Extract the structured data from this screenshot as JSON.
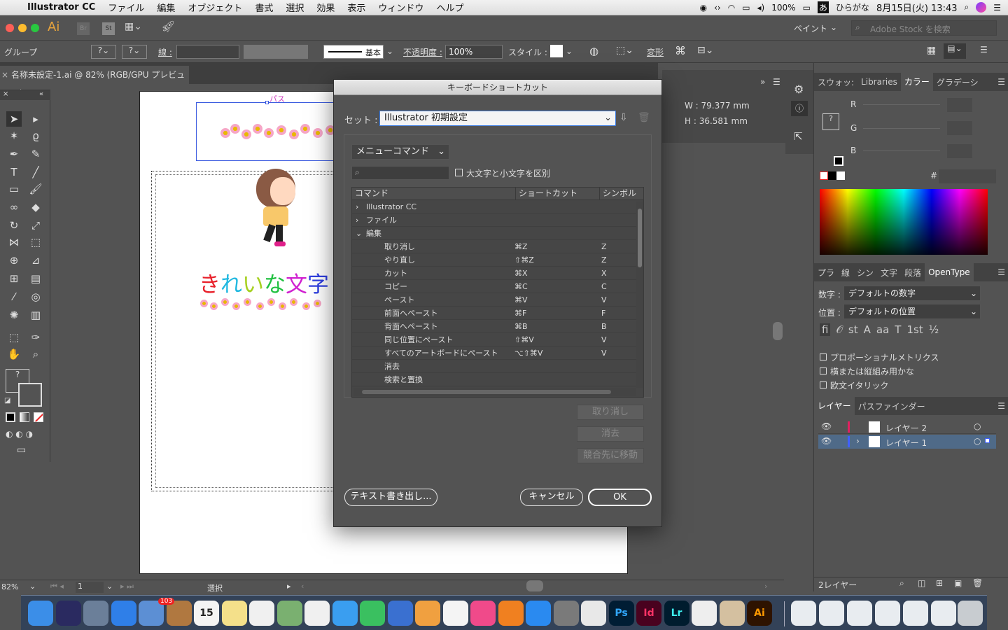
{
  "menubar": {
    "app": "Illustrator CC",
    "menus": [
      "ファイル",
      "編集",
      "オブジェクト",
      "書式",
      "選択",
      "効果",
      "表示",
      "ウィンドウ",
      "ヘルプ"
    ],
    "battery": "100%",
    "input": "ひらがな",
    "datetime": "8月15日(火) 13:43"
  },
  "appbar": {
    "ai": "Ai",
    "br": "Br",
    "st": "St",
    "workspace": "ペイント",
    "stock_placeholder": "Adobe Stock を検索"
  },
  "control": {
    "group": "グループ",
    "stroke_label": "線 :",
    "stroke_style": "基本",
    "opacity_label": "不透明度 :",
    "opacity": "100%",
    "style_label": "スタイル :",
    "transform": "変形"
  },
  "doc": {
    "tab": "名称未設定-1.ai @ 82% (RGB/GPU プレビュー)",
    "path_label": "パス",
    "art_text": [
      "き",
      "れ",
      "い",
      "な",
      "文",
      "字"
    ],
    "art_colors": [
      "#e8202a",
      "#20b8e0",
      "#a6d020",
      "#20c040",
      "#d020d0",
      "#3040e0"
    ]
  },
  "info": {
    "w": "W : 79.377 mm",
    "h": "H : 36.581 mm"
  },
  "status": {
    "zoom": "82%",
    "page": "1",
    "tool": "選択"
  },
  "dialog": {
    "title": "キーボードショートカット",
    "set_label": "セット :",
    "set_value": "Illustrator 初期設定",
    "category": "メニューコマンド",
    "case_label": "大文字と小文字を区別",
    "headers": [
      "コマンド",
      "ショートカット",
      "シンボル"
    ],
    "tree": [
      {
        "label": "Illustrator CC",
        "arrow": "›"
      },
      {
        "label": "ファイル",
        "arrow": "›"
      },
      {
        "label": "編集",
        "arrow": "⌄"
      }
    ],
    "commands": [
      {
        "name": "取り消し",
        "shortcut": "⌘Z",
        "symbol": "Z"
      },
      {
        "name": "やり直し",
        "shortcut": "⇧⌘Z",
        "symbol": "Z"
      },
      {
        "name": "カット",
        "shortcut": "⌘X",
        "symbol": "X"
      },
      {
        "name": "コピー",
        "shortcut": "⌘C",
        "symbol": "C"
      },
      {
        "name": "ペースト",
        "shortcut": "⌘V",
        "symbol": "V"
      },
      {
        "name": "前面へペースト",
        "shortcut": "⌘F",
        "symbol": "F"
      },
      {
        "name": "背面へペースト",
        "shortcut": "⌘B",
        "symbol": "B"
      },
      {
        "name": "同じ位置にペースト",
        "shortcut": "⇧⌘V",
        "symbol": "V"
      },
      {
        "name": "すべてのアートボードにペースト",
        "shortcut": "⌥⇧⌘V",
        "symbol": "V"
      },
      {
        "name": "消去",
        "shortcut": "",
        "symbol": ""
      },
      {
        "name": "検索と置換",
        "shortcut": "",
        "symbol": ""
      }
    ],
    "undo": "取り消し",
    "clear": "消去",
    "goto": "競合先に移動",
    "export": "テキスト書き出し...",
    "cancel": "キャンセル",
    "ok": "OK"
  },
  "panels": {
    "color_tabs": [
      "スウォッ:",
      "Libraries",
      "カラー",
      "グラデーシ"
    ],
    "rgb": [
      "R",
      "G",
      "B"
    ],
    "hash": "#",
    "type_tabs": [
      "プラ",
      "線",
      "シン",
      "文字",
      "段落",
      "OpenType"
    ],
    "number_label": "数字 :",
    "number_value": "デフォルトの数字",
    "position_label": "位置 :",
    "position_value": "デフォルトの位置",
    "glyphs": [
      "fi",
      "𝒪",
      "st",
      "A",
      "aa",
      "T",
      "1st",
      "½"
    ],
    "checks": [
      "プロポーショナルメトリクス",
      "横または縦組み用かな",
      "欧文イタリック"
    ],
    "layer_tabs": [
      "レイヤー",
      "パスファインダー"
    ],
    "layers": [
      {
        "name": "レイヤー 2",
        "color": "#e02060"
      },
      {
        "name": "レイヤー 1",
        "color": "#4060ff"
      }
    ],
    "layer_count": "2レイヤー"
  },
  "dock": {
    "apps": [
      "Finder",
      "Siri",
      "Launchpad",
      "Safari",
      "Mail",
      "Contacts",
      "Calendar",
      "Notes",
      "Reminders",
      "Maps",
      "Photos",
      "Messages",
      "FaceTime",
      "Keynote",
      "Pages",
      "Numbers",
      "iTunes",
      "iBooks",
      "App Store",
      "Prefs",
      "Preview",
      "Ps",
      "Id",
      "Lr",
      "Alpaca",
      "Script",
      "Ai"
    ],
    "calendar_day": "15",
    "badge": "103"
  }
}
